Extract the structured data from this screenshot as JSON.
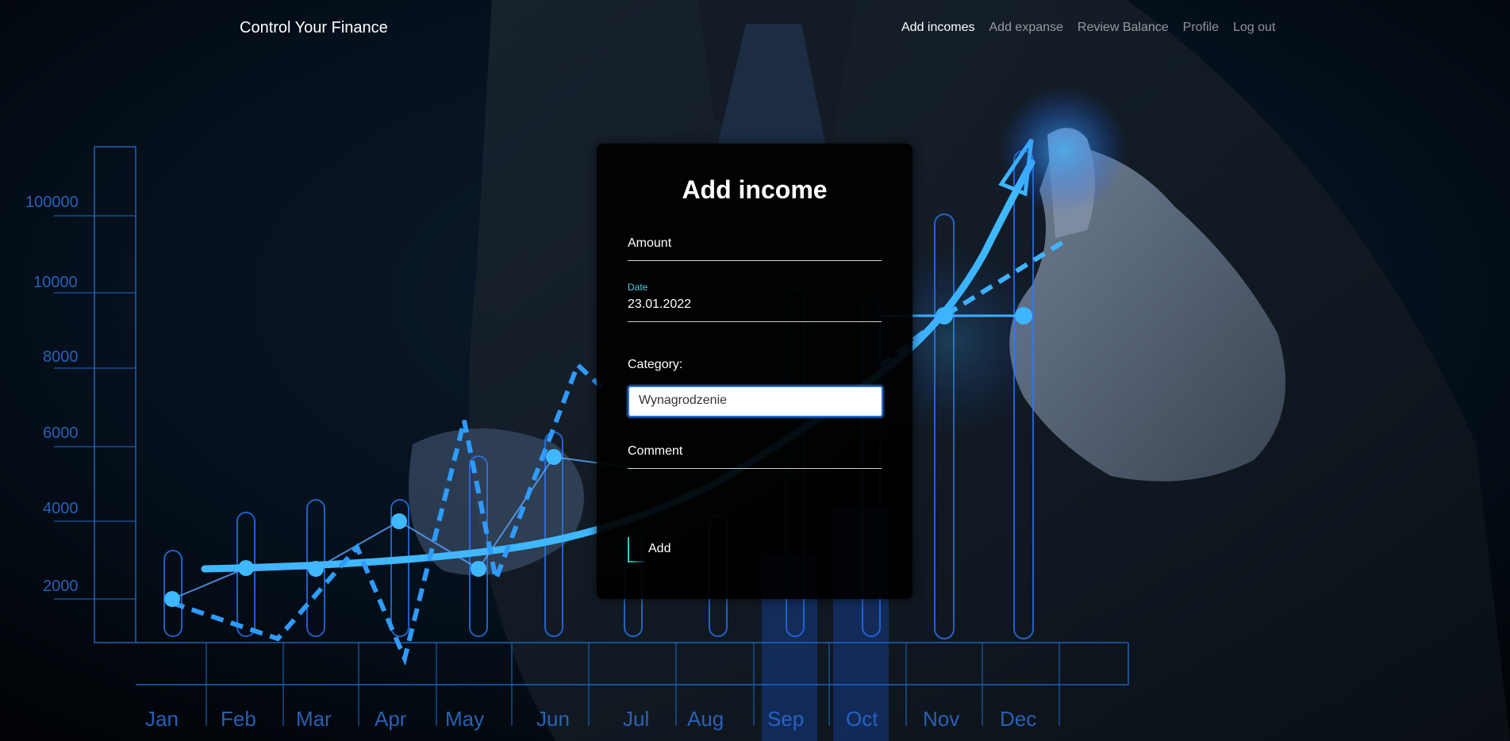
{
  "brand": "Control Your Finance",
  "nav": {
    "links": [
      "Add incomes",
      "Add expanse",
      "Review Balance",
      "Profile",
      "Log out"
    ],
    "active": "Add incomes"
  },
  "form": {
    "title": "Add income",
    "amount_label": "Amount",
    "date_label": "Date",
    "date_value": "23.01.2022",
    "category_label": "Category:",
    "category_value": "Wynagrodzenie",
    "comment_label": "Comment",
    "submit_label": "Add"
  },
  "background": {
    "y_ticks": [
      "100000",
      "10000",
      "8000",
      "6000",
      "4000",
      "2000"
    ],
    "months": [
      "Jan",
      "Feb",
      "Mar",
      "Apr",
      "May",
      "Jun",
      "Jul",
      "Aug",
      "Sep",
      "Oct",
      "Nov",
      "Dec"
    ]
  },
  "colors": {
    "accent": "#3cc7c9",
    "chart_blue": "#2a8cff",
    "link_muted": "#8c8c8c"
  }
}
